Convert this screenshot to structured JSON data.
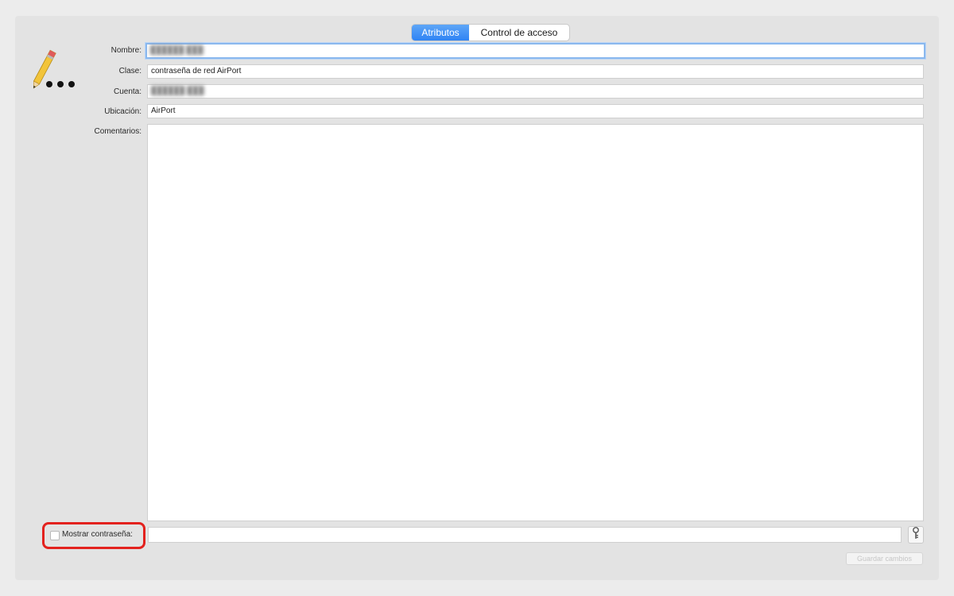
{
  "tabs": [
    {
      "label": "Atributos",
      "active": true
    },
    {
      "label": "Control de acceso",
      "active": false
    }
  ],
  "form": {
    "name_label": "Nombre:",
    "name_value": "██████ ███",
    "class_label": "Clase:",
    "class_value": "contraseña de red AirPort",
    "account_label": "Cuenta:",
    "account_value": "██████ ███",
    "location_label": "Ubicación:",
    "location_value": "AirPort",
    "comments_label": "Comentarios:",
    "comments_value": ""
  },
  "password": {
    "show_label": "Mostrar contraseña:",
    "checked": false,
    "value": ""
  },
  "actions": {
    "save_label": "Guardar cambios",
    "save_enabled": false
  },
  "icons": {
    "item_icon": "pencil-password-icon",
    "key_button_icon": "key-icon"
  },
  "colors": {
    "accent": "#2f83f4",
    "highlight_outline": "#e3221e",
    "focus_ring": "#8ab8ee"
  }
}
